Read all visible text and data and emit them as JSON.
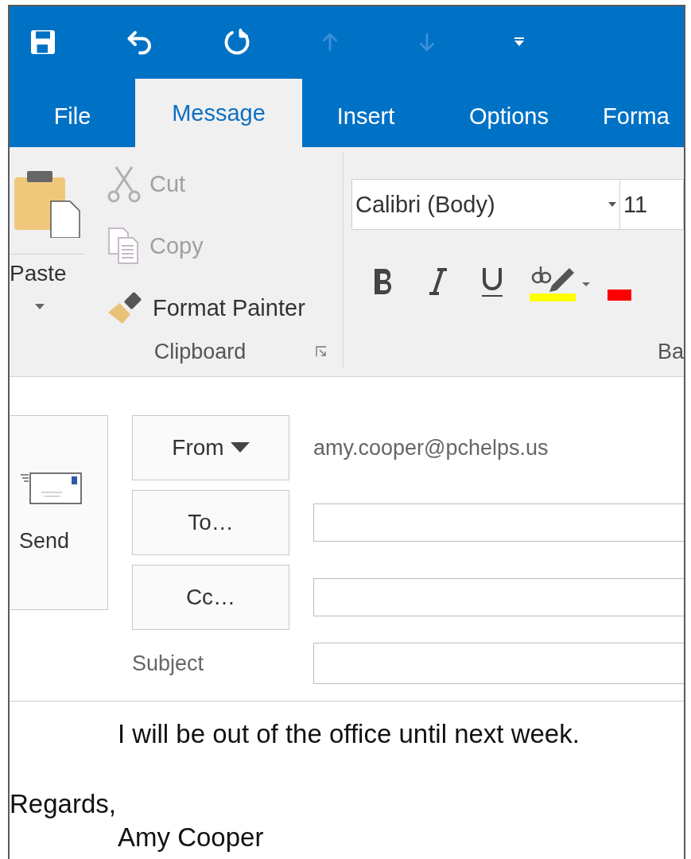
{
  "quick_access": [
    {
      "kind": "save",
      "disabled": false
    },
    {
      "kind": "undo",
      "disabled": false
    },
    {
      "kind": "redo",
      "disabled": false
    },
    {
      "kind": "up",
      "disabled": true
    },
    {
      "kind": "down",
      "disabled": true
    },
    {
      "kind": "customize",
      "disabled": false
    }
  ],
  "tabs": [
    {
      "label": "File",
      "selected": false
    },
    {
      "label": "Message",
      "selected": true
    },
    {
      "label": "Insert",
      "selected": false
    },
    {
      "label": "Options",
      "selected": false
    },
    {
      "label": "Forma",
      "selected": false
    }
  ],
  "ribbon": {
    "clipboard": {
      "paste": "Paste",
      "label": "Clipboard",
      "commands": [
        {
          "kind": "cut",
          "label": "Cut",
          "disabled": true
        },
        {
          "kind": "copy",
          "label": "Copy",
          "disabled": true
        },
        {
          "kind": "painter",
          "label": "Format Painter",
          "disabled": false
        }
      ]
    },
    "basic_text": {
      "font": "Calibri (Body)",
      "size": "11",
      "label": "Ba"
    }
  },
  "compose": {
    "send": "Send",
    "from": "From",
    "from_address": "amy.cooper@pchelps.us",
    "to": "To…",
    "cc": "Cc…",
    "subject": "Subject"
  },
  "body": [
    {
      "text": "I will be out of the office until next week.",
      "kind": "indented"
    },
    {
      "text": "Regards,",
      "kind": "plain"
    },
    {
      "text": "Amy Cooper",
      "kind": "indented"
    }
  ]
}
